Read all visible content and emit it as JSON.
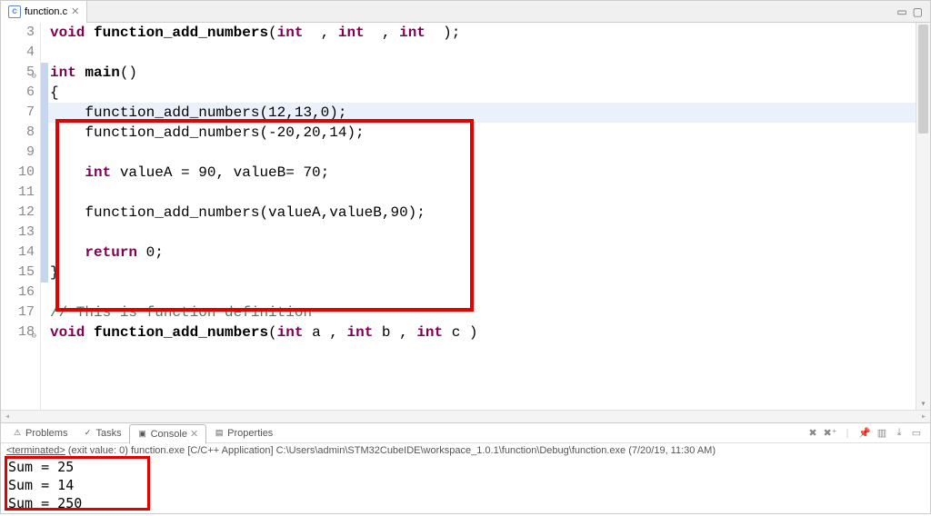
{
  "tab": {
    "filename": "function.c",
    "icon_letter": "c"
  },
  "gutter": {
    "3": "3",
    "4": "4",
    "5": "5",
    "6": "6",
    "7": "7",
    "8": "8",
    "9": "9",
    "10": "10",
    "11": "11",
    "12": "12",
    "13": "13",
    "14": "14",
    "15": "15",
    "16": "16",
    "17": "17",
    "18": "18"
  },
  "code": {
    "l3": {
      "kw": "void",
      "fn": "function_add_numbers",
      "sig": "(",
      "t1": "int",
      "c1": "  , ",
      "t2": "int",
      "c2": "  , ",
      "t3": "int",
      "end": "  );"
    },
    "l4": "",
    "l5": {
      "kw": "int",
      "fn": "main",
      "rest": "()"
    },
    "l6": "{",
    "l7": "    function_add_numbers(12,13,0);",
    "l8": "    function_add_numbers(-20,20,14);",
    "l9": "",
    "l10": {
      "kw": "int",
      "rest": " valueA = 90, valueB= 70;"
    },
    "l11": "",
    "l12": "    function_add_numbers(valueA,valueB,90);",
    "l13": "",
    "l14": {
      "kw": "return",
      "rest": " 0;"
    },
    "l15": "}",
    "l16": "",
    "l17": "// This is function definition",
    "l18": {
      "kw": "void",
      "fn": "function_add_numbers",
      "sig": "(",
      "a": "int",
      "ar": " a , ",
      "b": "int",
      "br": " b , ",
      "c": "int",
      "cr": " c )"
    }
  },
  "bottom": {
    "tabs": {
      "problems": "Problems",
      "tasks": "Tasks",
      "console": "Console",
      "properties": "Properties"
    },
    "terminated_prefix": "<terminated>",
    "terminated_rest": " (exit value: 0) function.exe [C/C++ Application] C:\\Users\\admin\\STM32CubeIDE\\workspace_1.0.1\\function\\Debug\\function.exe (7/20/19, 11:30 AM)",
    "out1": "Sum = 25",
    "out2": "Sum = 14",
    "out3": "Sum = 250"
  }
}
